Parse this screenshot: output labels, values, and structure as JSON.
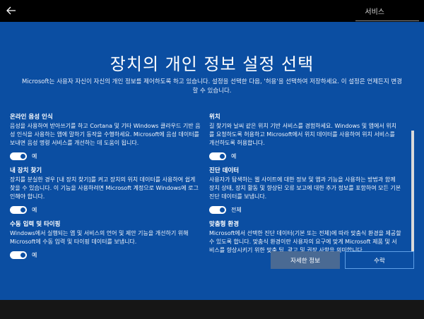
{
  "topbar": {
    "back_icon": "back-arrow-icon",
    "title": "서비스"
  },
  "page": {
    "title": "장치의 개인 정보 설정 선택",
    "subtitle": "Microsoft는 사용자 자신이 자신의 개인 정보를 제어하도록 하고 있습니다. 설정을 선택한 다음, '허용'을 선택하여 저장하세요. 이 설정은 언제든지 변경할 수 있습니다."
  },
  "settings_left": [
    {
      "title": "온라인 음성 인식",
      "desc": "음성을 사용하여 받아쓰기를 하고 Cortana 및 기타 Windows 클라우드 기반 음성 인식을 사용하는 앱에 말하기 동작을 수행하세요. Microsoft에 음성 데이터를 보내면 음성 명령 서비스를 개선하는 데 도움이 됩니다.",
      "toggle_state": "on",
      "toggle_label": "예"
    },
    {
      "title": "내 장치 찾기",
      "desc": "장치를 분실한 경우 [내 장치 찾기]를 켜고 장치의 위치 데이터를 사용하여 쉽게 찾을 수 있습니다. 이 기능을 사용하려면 Microsoft 계정으로 Windows에 로그인해야 합니다.",
      "toggle_state": "on",
      "toggle_label": "예"
    },
    {
      "title": "수동 입력 및 타이핑",
      "desc": "Windows에서 실행되는 앱 및 서비스의 언어 및 제안 기능을 개선하기 위해 Microsoft에 수동 입력 및 타이핑 데이터를 보냅니다.",
      "toggle_state": "on",
      "toggle_label": "예"
    }
  ],
  "settings_right": [
    {
      "title": "위치",
      "desc": "길 찾기와 날씨 같은 위치 기반 서비스를 경험하세요. Windows 및 앱에서 위치를 요청하도록 허용하고 Microsoft에서 위치 데이터를 사용하여 위치 서비스를 개선하도록 허용합니다.",
      "toggle_state": "on",
      "toggle_label": "예"
    },
    {
      "title": "진단 데이터",
      "desc": "사용자가 탐색하는 웹 사이트에 대한 정보 및 앱과 기능을 사용하는 방법과 함께 장치 상태, 장치 활동 및 향상된 오류 보고에 대한 추가 정보를 포함하여 모든 기본 진단 데이터를 보냅니다.",
      "toggle_state": "on",
      "toggle_label": "전체"
    },
    {
      "title": "맞춤형 환경",
      "desc": "Microsoft에서 선택한 진단 데이터(기본 또는 전체)에 따라 맞춤식 환경을 제공할 수 있도록 합니다. 맞춤식 환경이란 사용자의 요구에 맞게 Microsoft 제품 및 서비스를 향상시키기 위한 맞춤 팁, 광고 및 권장 사항을 의미합니다.",
      "toggle_state": "none",
      "toggle_label": ""
    }
  ],
  "buttons": {
    "details": "자세한 정보",
    "accept": "수락"
  },
  "colors": {
    "background": "#0b4ea2",
    "toggle_on": "#ffffff",
    "topbar": "#000000"
  }
}
